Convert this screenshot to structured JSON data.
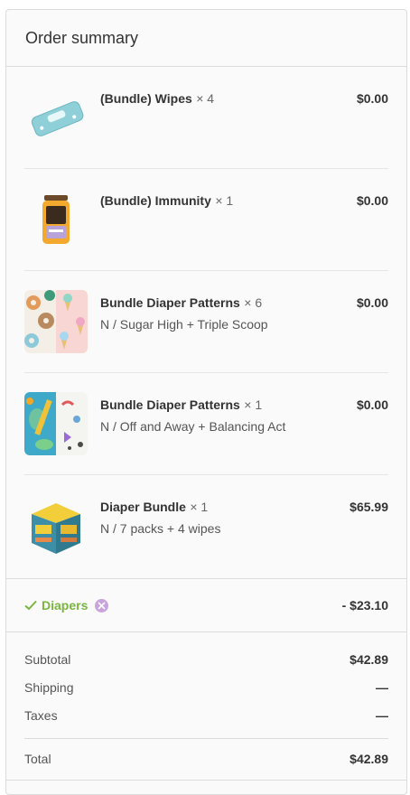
{
  "header": {
    "title": "Order summary"
  },
  "items": [
    {
      "name": "(Bundle) Wipes",
      "qty": "× 4",
      "variant": "",
      "price": "$0.00",
      "icon": "wipes-image"
    },
    {
      "name": "(Bundle) Immunity",
      "qty": "× 1",
      "variant": "",
      "price": "$0.00",
      "icon": "immunity-jar-image"
    },
    {
      "name": "Bundle Diaper Patterns",
      "qty": "× 6",
      "variant": "N / Sugar High + Triple Scoop",
      "price": "$0.00",
      "icon": "diaper-pattern-image"
    },
    {
      "name": "Bundle Diaper Patterns",
      "qty": "× 1",
      "variant": "N / Off and Away + Balancing Act",
      "price": "$0.00",
      "icon": "diaper-pattern-image"
    },
    {
      "name": "Diaper Bundle",
      "qty": "× 1",
      "variant": "N / 7 packs + 4 wipes",
      "price": "$65.99",
      "icon": "diaper-box-image"
    }
  ],
  "discount": {
    "code": "Diapers",
    "amount": "- $23.10",
    "colors": {
      "tag": "#7ab63f",
      "remove": "#c9a4dc"
    }
  },
  "totals": {
    "subtotal_label": "Subtotal",
    "subtotal_value": "$42.89",
    "shipping_label": "Shipping",
    "shipping_value": "—",
    "taxes_label": "Taxes",
    "taxes_value": "—",
    "total_label": "Total",
    "total_value": "$42.89"
  }
}
